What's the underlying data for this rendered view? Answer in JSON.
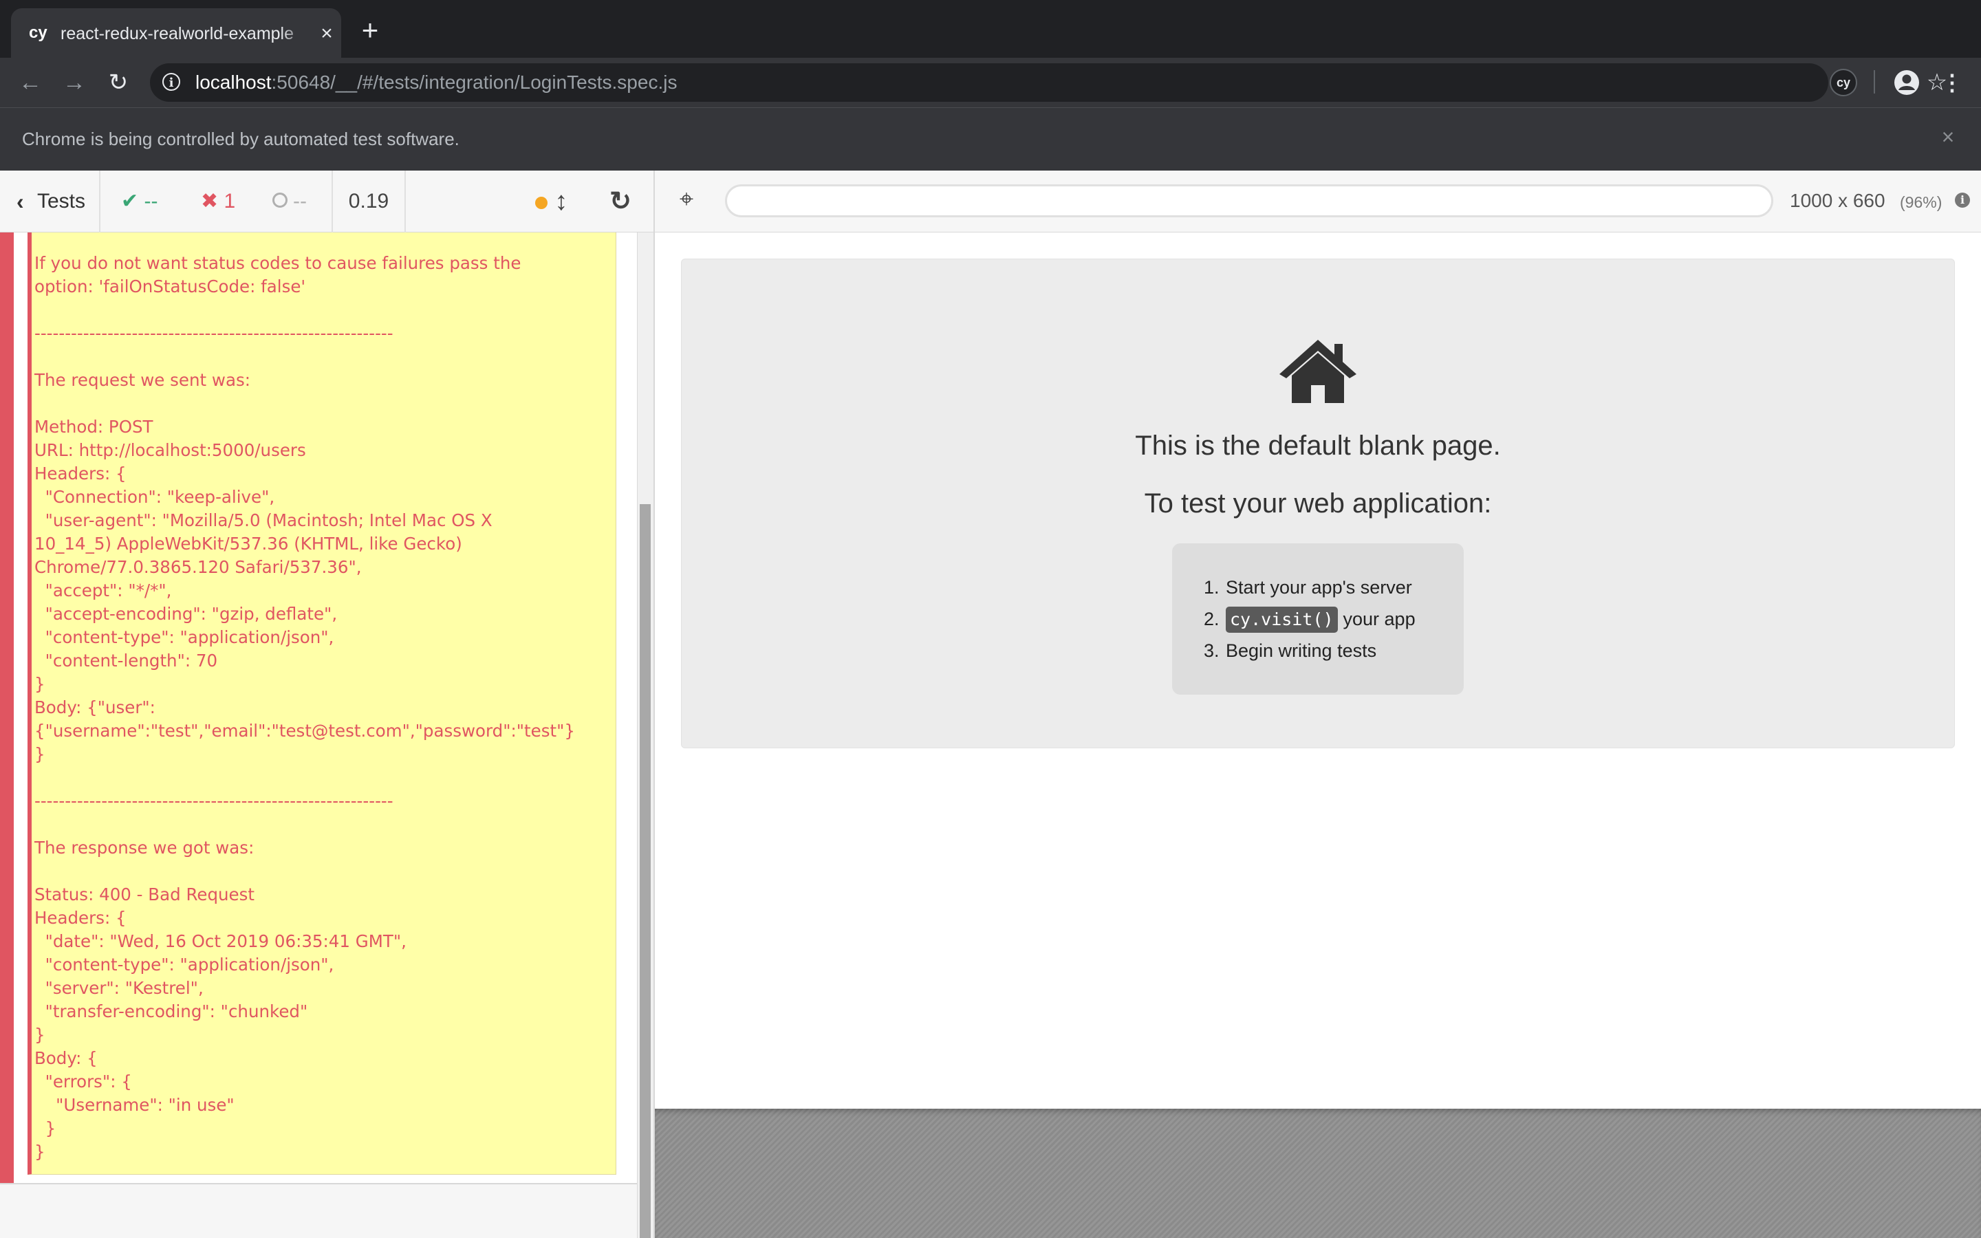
{
  "browser": {
    "tab": {
      "favicon": "cy",
      "title": "react-redux-realworld-example-app",
      "close": "×"
    },
    "new_tab": "+",
    "url": {
      "host": "localhost",
      "rest": ":50648/__/#/tests/integration/LoginTests.spec.js"
    },
    "extension_label": "cy",
    "infobar": {
      "message": "Chrome is being controlled by automated test software.",
      "close": "×"
    }
  },
  "reporter": {
    "tests_label": "Tests",
    "stats": {
      "passed": "--",
      "failed": "1",
      "pending": "--"
    },
    "duration": "0.19",
    "error_text": "If you do not want status codes to cause failures pass the\noption: 'failOnStatusCode: false'\n\n-----------------------------------------------------------\n\nThe request we sent was:\n\nMethod: POST\nURL: http://localhost:5000/users\nHeaders: {\n  \"Connection\": \"keep-alive\",\n  \"user-agent\": \"Mozilla/5.0 (Macintosh; Intel Mac OS X\n10_14_5) AppleWebKit/537.36 (KHTML, like Gecko)\nChrome/77.0.3865.120 Safari/537.36\",\n  \"accept\": \"*/*\",\n  \"accept-encoding\": \"gzip, deflate\",\n  \"content-type\": \"application/json\",\n  \"content-length\": 70\n}\nBody: {\"user\":\n{\"username\":\"test\",\"email\":\"test@test.com\",\"password\":\"test\"}\n}\n\n-----------------------------------------------------------\n\nThe response we got was:\n\nStatus: 400 - Bad Request\nHeaders: {\n  \"date\": \"Wed, 16 Oct 2019 06:35:41 GMT\",\n  \"content-type\": \"application/json\",\n  \"server\": \"Kestrel\",\n  \"transfer-encoding\": \"chunked\"\n}\nBody: {\n  \"errors\": {\n    \"Username\": \"in use\"\n  }\n}"
  },
  "aut": {
    "url_value": "",
    "viewport_size": "1000 x 660",
    "viewport_scale": "(96%)",
    "blank_page": {
      "title": "This is the default blank page.",
      "subtitle": "To test your web application:",
      "steps": [
        {
          "num": "1.",
          "text": "Start your app's server"
        },
        {
          "num": "2.",
          "code": "cy.visit()",
          "text": "your app"
        },
        {
          "num": "3.",
          "text": "Begin writing tests"
        }
      ]
    }
  },
  "colors": {
    "fail": "#e05561",
    "pass": "#3aa675",
    "error_bg": "#ffffa8",
    "pending_dot": "#f5a623"
  }
}
